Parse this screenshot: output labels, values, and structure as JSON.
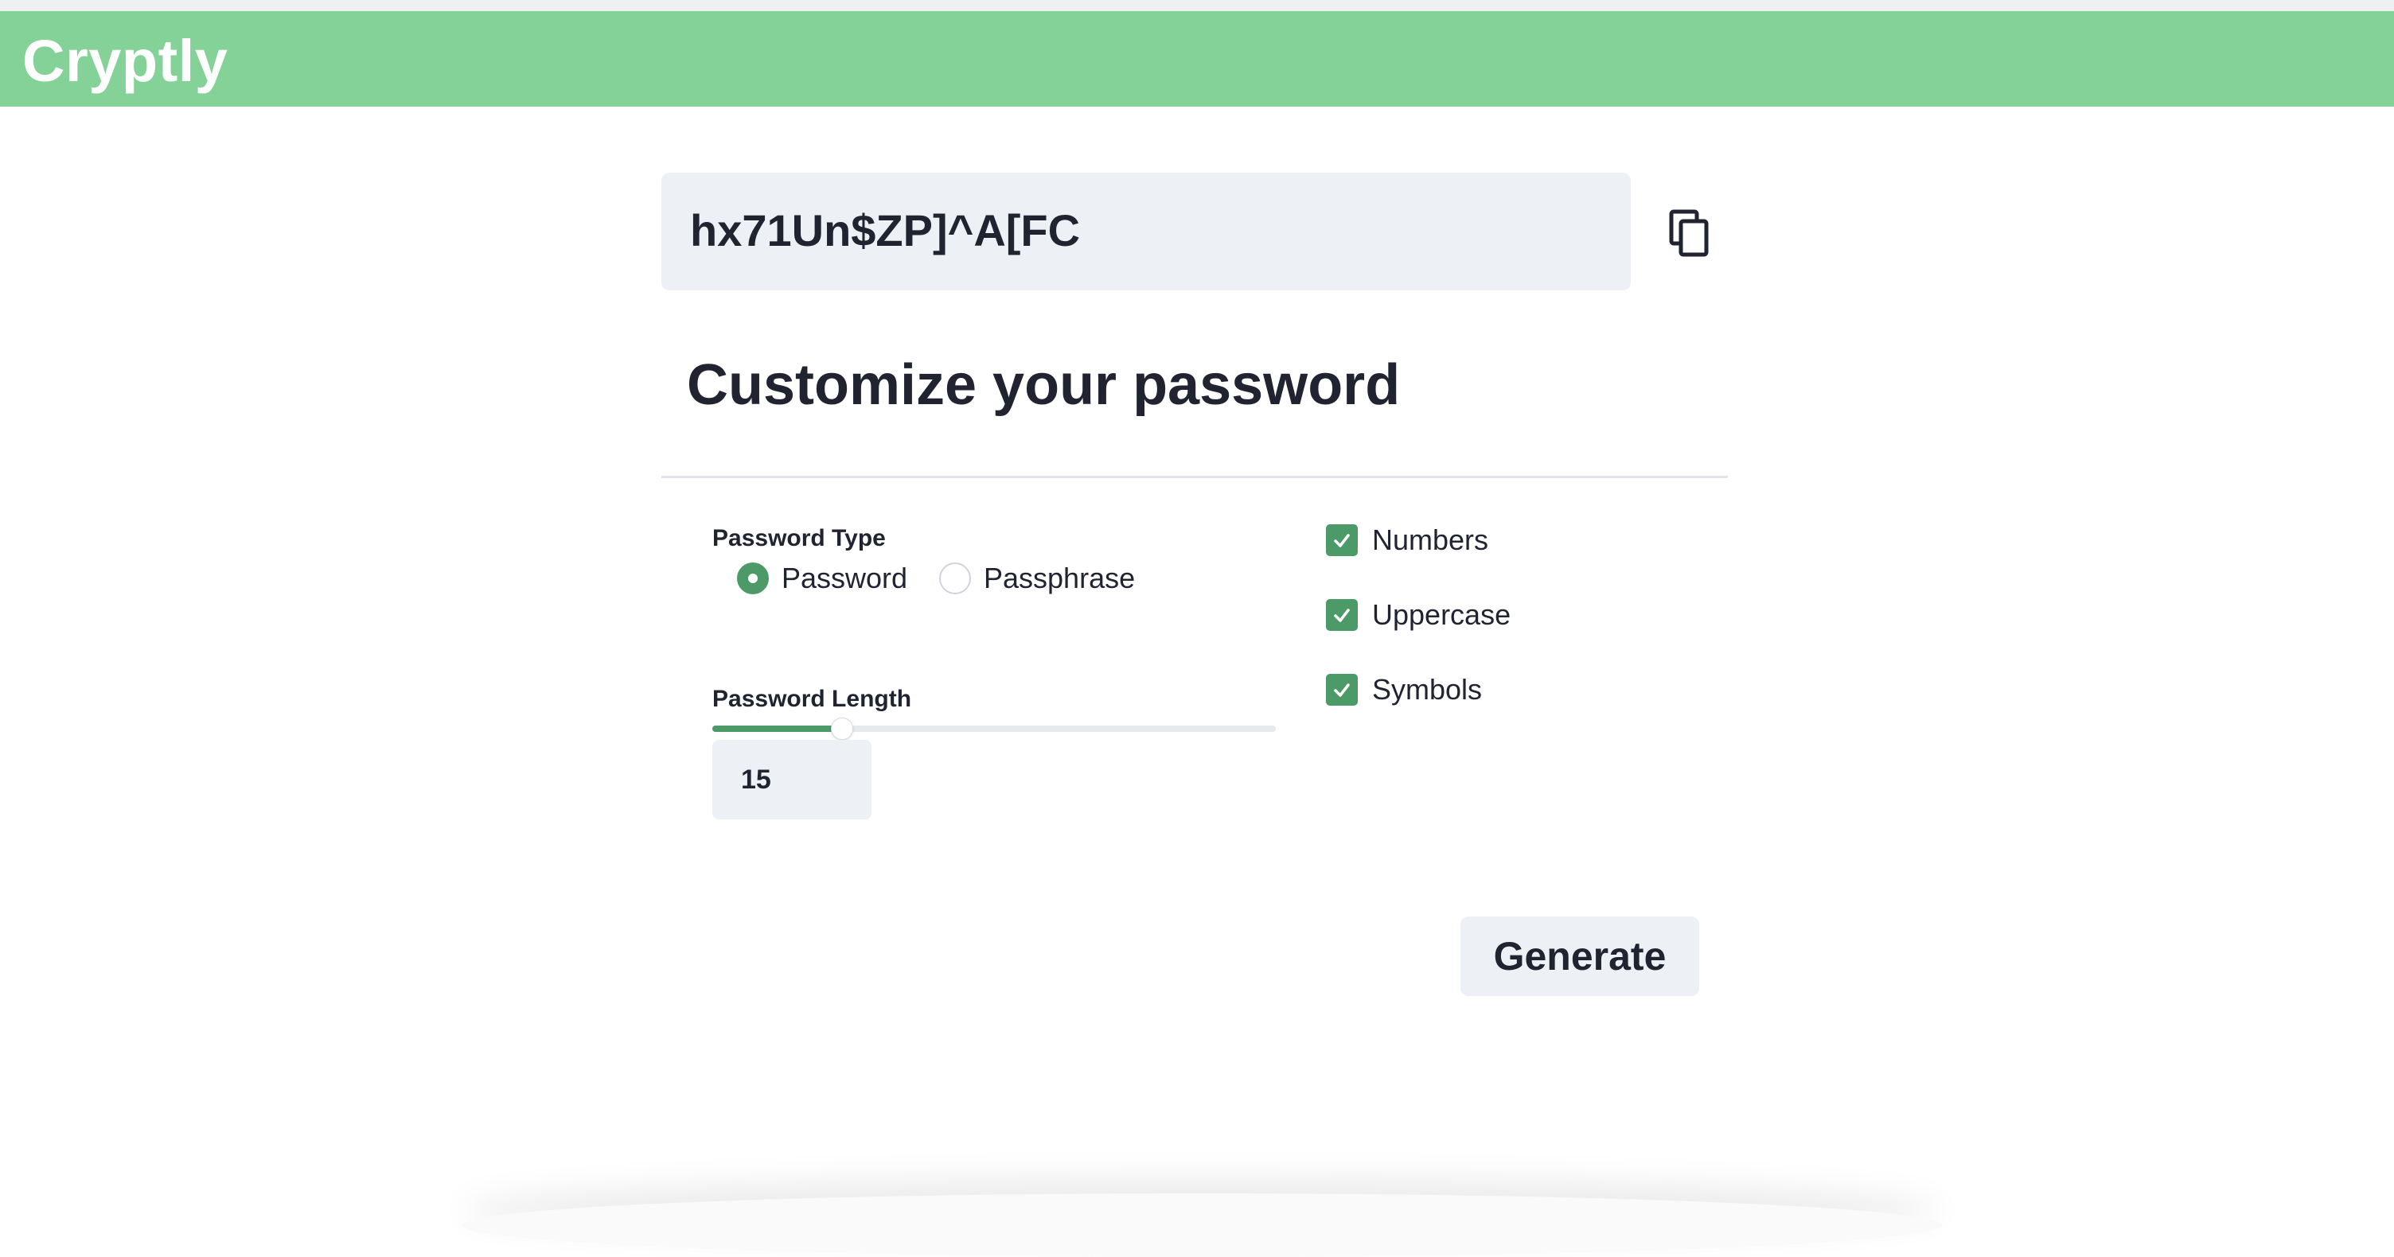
{
  "app": {
    "title": "Cryptly"
  },
  "password": {
    "value": "hx71Un$ZP]^A[FC"
  },
  "icons": {
    "copy": "copy-icon",
    "check": "check-icon"
  },
  "customize": {
    "title": "Customize your password"
  },
  "password_type": {
    "label": "Password Type",
    "options": [
      {
        "label": "Password",
        "checked": true
      },
      {
        "label": "Passphrase",
        "checked": false
      }
    ]
  },
  "password_length": {
    "label": "Password Length",
    "value": "15",
    "slider_fraction": 0.23
  },
  "options": [
    {
      "label": "Numbers",
      "checked": true
    },
    {
      "label": "Uppercase",
      "checked": true
    },
    {
      "label": "Symbols",
      "checked": true
    }
  ],
  "actions": {
    "generate_label": "Generate"
  },
  "colors": {
    "header": "#84d298",
    "accent": "#4c9a68",
    "field_bg": "#edf1f5"
  }
}
